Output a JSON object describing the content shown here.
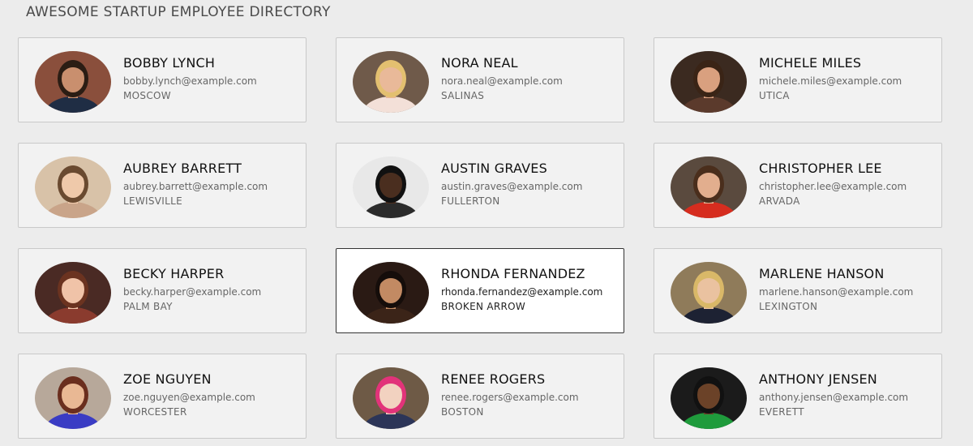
{
  "header": {
    "title": "AWESOME STARTUP EMPLOYEE DIRECTORY"
  },
  "employees": [
    {
      "name": "BOBBY LYNCH",
      "email": "bobby.lynch@example.com",
      "city": "MOSCOW",
      "photo_bg": "#8a4f3c",
      "skin": "#c98f6e",
      "hair": "#2b1d14",
      "shirt": "#1f2d44"
    },
    {
      "name": "NORA NEAL",
      "email": "nora.neal@example.com",
      "city": "SALINAS",
      "photo_bg": "#6f5a4a",
      "skin": "#e9b999",
      "hair": "#e3c070",
      "shirt": "#f3e0d8"
    },
    {
      "name": "MICHELE MILES",
      "email": "michele.miles@example.com",
      "city": "UTICA",
      "photo_bg": "#3b2a20",
      "skin": "#d9a07f",
      "hair": "#3a2416",
      "shirt": "#5b3a2c"
    },
    {
      "name": "AUBREY BARRETT",
      "email": "aubrey.barrett@example.com",
      "city": "LEWISVILLE",
      "photo_bg": "#d8c2a8",
      "skin": "#efc9aa",
      "hair": "#6a4a30",
      "shirt": "#c9a489"
    },
    {
      "name": "AUSTIN GRAVES",
      "email": "austin.graves@example.com",
      "city": "FULLERTON",
      "photo_bg": "#e8e8e8",
      "skin": "#4a2e1f",
      "hair": "#111111",
      "shirt": "#2b2b2b"
    },
    {
      "name": "CHRISTOPHER LEE",
      "email": "christopher.lee@example.com",
      "city": "ARVADA",
      "photo_bg": "#5a4a3e",
      "skin": "#e2ae8e",
      "hair": "#4a2e1c",
      "shirt": "#d62d1f"
    },
    {
      "name": "BECKY HARPER",
      "email": "becky.harper@example.com",
      "city": "PALM BAY",
      "photo_bg": "#4a2a24",
      "skin": "#f0c3a8",
      "hair": "#6b3320",
      "shirt": "#8a3b2e"
    },
    {
      "name": "RHONDA FERNANDEZ",
      "email": "rhonda.fernandez@example.com",
      "city": "BROKEN ARROW",
      "photo_bg": "#2a1a14",
      "skin": "#c28a63",
      "hair": "#150d0a",
      "shirt": "#3b2418"
    },
    {
      "name": "MARLENE HANSON",
      "email": "marlene.hanson@example.com",
      "city": "LEXINGTON",
      "photo_bg": "#8f7b5a",
      "skin": "#eac2a0",
      "hair": "#d9b868",
      "shirt": "#1d2233"
    },
    {
      "name": "ZOE NGUYEN",
      "email": "zoe.nguyen@example.com",
      "city": "WORCESTER",
      "photo_bg": "#b7a89a",
      "skin": "#e9b894",
      "hair": "#6a2e1e",
      "shirt": "#3a3cc4"
    },
    {
      "name": "RENEE ROGERS",
      "email": "renee.rogers@example.com",
      "city": "BOSTON",
      "photo_bg": "#6e5a46",
      "skin": "#f2d2c0",
      "hair": "#e2337a",
      "shirt": "#2c3558"
    },
    {
      "name": "ANTHONY JENSEN",
      "email": "anthony.jensen@example.com",
      "city": "EVERETT",
      "photo_bg": "#1b1b1b",
      "skin": "#6b4228",
      "hair": "#111111",
      "shirt": "#1f9b3c"
    }
  ],
  "selected_index": 7
}
